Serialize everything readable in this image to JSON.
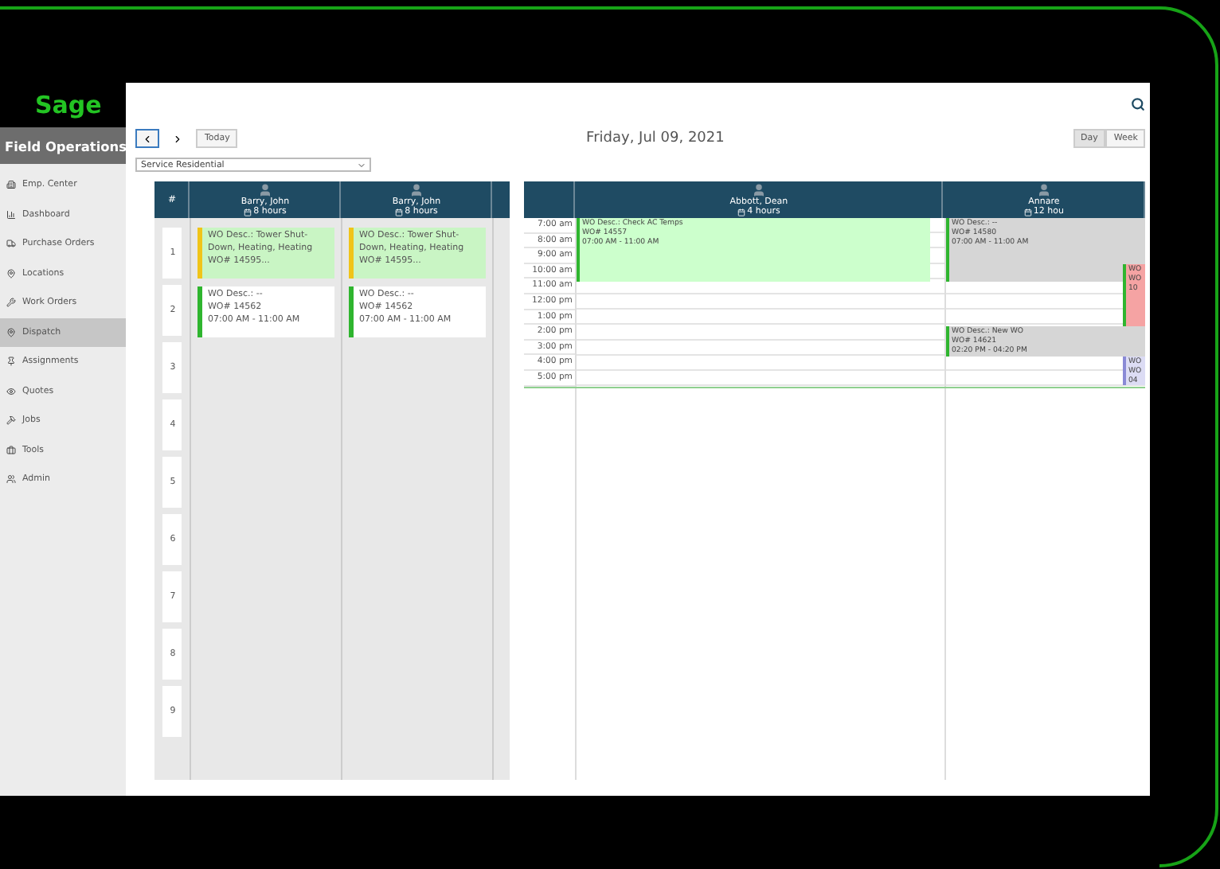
{
  "sidebar": {
    "logo": "Sage",
    "title": "Field Operations",
    "items": [
      {
        "label": "Emp. Center",
        "selected": false
      },
      {
        "label": "Dashboard",
        "selected": false
      },
      {
        "label": "Purchase Orders",
        "selected": false
      },
      {
        "label": "Locations",
        "selected": false
      },
      {
        "label": "Work Orders",
        "selected": false
      },
      {
        "label": "Dispatch",
        "selected": true
      },
      {
        "label": "Assignments",
        "selected": false
      },
      {
        "label": "Quotes",
        "selected": false
      },
      {
        "label": "Jobs",
        "selected": false
      },
      {
        "label": "Tools",
        "selected": false
      },
      {
        "label": "Admin",
        "selected": false
      }
    ]
  },
  "toolbar": {
    "today": "Today",
    "date": "Friday, Jul 09, 2021",
    "views": [
      {
        "label": "Day",
        "selected": true
      },
      {
        "label": "Week",
        "selected": false
      }
    ]
  },
  "filter": {
    "value": "Service Residential"
  },
  "board": {
    "number_heading": "#",
    "rows": [
      "1",
      "2",
      "3",
      "4",
      "5",
      "6",
      "7",
      "8",
      "9"
    ],
    "columns": [
      {
        "name": "Barry, John",
        "hours": "8 hours",
        "cards": [
          {
            "kind": "pending",
            "lines": [
              "WO Desc.: Tower Shut-Down, Heating, Heating",
              "WO# 14595..."
            ]
          },
          {
            "kind": "scheduled",
            "lines": [
              "WO Desc.: --",
              "WO# 14562",
              "07:00 AM - 11:00 AM"
            ]
          }
        ]
      },
      {
        "name": "Barry, John",
        "hours": "8 hours",
        "cards": [
          {
            "kind": "pending",
            "lines": [
              "WO Desc.: Tower Shut-Down, Heating, Heating",
              "WO# 14595..."
            ]
          },
          {
            "kind": "scheduled",
            "lines": [
              "WO Desc.: --",
              "WO# 14562",
              "07:00 AM - 11:00 AM"
            ]
          }
        ]
      }
    ]
  },
  "calendar": {
    "times": [
      "7:00 am",
      "8:00 am",
      "9:00 am",
      "10:00 am",
      "11:00 am",
      "12:00 pm",
      "1:00 pm",
      "2:00 pm",
      "3:00 pm",
      "4:00 pm",
      "5:00 pm"
    ],
    "columns": [
      {
        "name": "Abbott, Dean",
        "hours": "4 hours",
        "events": [
          {
            "kind": "done",
            "lines": [
              "WO Desc.: Check AC Temps",
              "WO# 14557",
              "07:00 AM - 11:00 AM"
            ]
          }
        ]
      },
      {
        "name": "Annare",
        "hours": "12 hou",
        "events": [
          {
            "kind": "open",
            "lines": [
              "WO Desc.: --",
              "WO# 14580",
              "07:00 AM - 11:00 AM"
            ]
          },
          {
            "kind": "late",
            "lines": [
              "WO",
              "WO",
              "10"
            ]
          },
          {
            "kind": "open",
            "lines": [
              "WO Desc.: New WO",
              "WO# 14621",
              "02:20 PM - 04:20 PM"
            ]
          },
          {
            "kind": "new",
            "lines": [
              "WO",
              "WO",
              "04"
            ]
          }
        ]
      }
    ]
  }
}
